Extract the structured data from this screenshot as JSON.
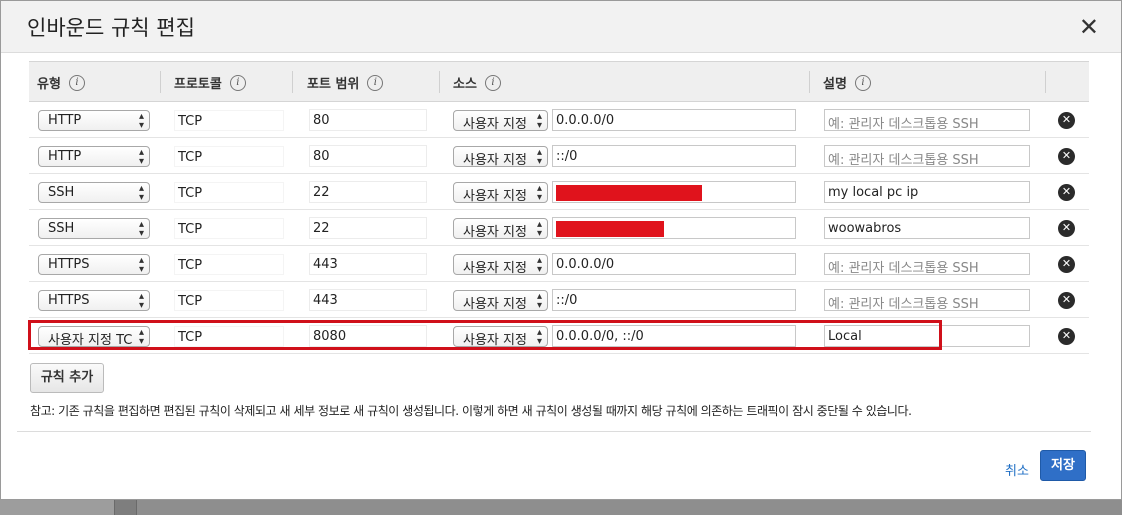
{
  "dialog": {
    "title": "인바운드 규칙 편집",
    "close_label": "✕"
  },
  "columns": {
    "type": "유형",
    "protocol": "프로토콜",
    "port_range": "포트 범위",
    "source": "소스",
    "description": "설명",
    "info_glyph": "i"
  },
  "rules": [
    {
      "type": "HTTP",
      "protocol": "TCP",
      "port": "80",
      "source_type": "사용자 지정",
      "source": "0.0.0.0/0",
      "description": "",
      "description_placeholder": "예: 관리자 데스크톱용 SSH"
    },
    {
      "type": "HTTP",
      "protocol": "TCP",
      "port": "80",
      "source_type": "사용자 지정",
      "source": "::/0",
      "description": "",
      "description_placeholder": "예: 관리자 데스크톱용 SSH"
    },
    {
      "type": "SSH",
      "protocol": "TCP",
      "port": "22",
      "source_type": "사용자 지정",
      "source": "",
      "source_redacted": true,
      "description": "my local pc ip",
      "description_placeholder": ""
    },
    {
      "type": "SSH",
      "protocol": "TCP",
      "port": "22",
      "source_type": "사용자 지정",
      "source": "",
      "source_redacted": true,
      "description": "woowabros",
      "description_placeholder": ""
    },
    {
      "type": "HTTPS",
      "protocol": "TCP",
      "port": "443",
      "source_type": "사용자 지정",
      "source": "0.0.0.0/0",
      "description": "",
      "description_placeholder": "예: 관리자 데스크톱용 SSH"
    },
    {
      "type": "HTTPS",
      "protocol": "TCP",
      "port": "443",
      "source_type": "사용자 지정",
      "source": "::/0",
      "description": "",
      "description_placeholder": "예: 관리자 데스크톱용 SSH"
    },
    {
      "type": "사용자 지정 TC",
      "protocol": "TCP",
      "port": "8080",
      "source_type": "사용자 지정",
      "source": "0.0.0.0/0, ::/0",
      "description": "Local",
      "description_placeholder": "",
      "highlighted": true
    }
  ],
  "add_rule_label": "규칙 추가",
  "note": "참고: 기존 규칙을 편집하면 편집된 규칙이 삭제되고 새 세부 정보로 새 규칙이 생성됩니다. 이렇게 하면 새 규칙이 생성될 때까지 해당 규칙에 의존하는 트래픽이 잠시 중단될 수 있습니다.",
  "footer": {
    "cancel_label": "취소",
    "save_label": "저장"
  },
  "colors": {
    "highlight": "#d0101a",
    "redaction": "#e0131c",
    "primary_button": "#2f6fc7",
    "link": "#1f6fc5"
  }
}
